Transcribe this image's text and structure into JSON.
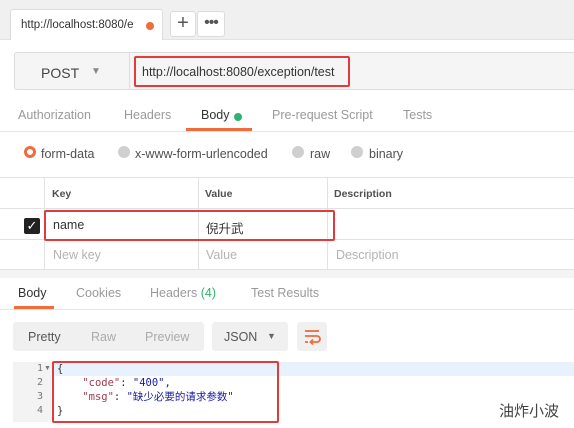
{
  "colors": {
    "accent": "#f26b3a",
    "highlight_box": "#e23b3b",
    "status_green": "#2fb170"
  },
  "tabbar": {
    "active_tab_label": "http://localhost:8080/e",
    "unsaved_indicator": "#f26b3a",
    "add_tab_label": "+",
    "more_tabs_label": "•••"
  },
  "request": {
    "method": "POST",
    "url": "http://localhost:8080/exception/test"
  },
  "request_tabs": {
    "authorization": "Authorization",
    "headers": "Headers",
    "body": "Body",
    "prerequest": "Pre-request Script",
    "tests": "Tests"
  },
  "body_modes": {
    "form_data": "form-data",
    "urlencoded": "x-www-form-urlencoded",
    "raw": "raw",
    "binary": "binary",
    "selected": "form-data"
  },
  "kv_table": {
    "headers": {
      "key": "Key",
      "value": "Value",
      "description": "Description"
    },
    "row": {
      "checked": true,
      "key": "name",
      "value": "倪升武",
      "description": ""
    },
    "new_row": {
      "key_placeholder": "New key",
      "value_placeholder": "Value",
      "description_placeholder": "Description"
    }
  },
  "response_tabs": {
    "body": "Body",
    "cookies": "Cookies",
    "headers": "Headers",
    "headers_count": "(4)",
    "test_results": "Test Results"
  },
  "view_toolbar": {
    "pretty": "Pretty",
    "raw": "Raw",
    "preview": "Preview",
    "format": "JSON",
    "wrap_icon": "wrap-lines-icon"
  },
  "response_body": {
    "line_numbers": [
      "1",
      "2",
      "3",
      "4"
    ],
    "open_brace": "{",
    "close_brace": "}",
    "code_key": "\"code\"",
    "code_value": "\"400\"",
    "msg_key": "\"msg\"",
    "msg_value": "\"缺少必要的请求参数\""
  },
  "watermark": "油炸小波"
}
